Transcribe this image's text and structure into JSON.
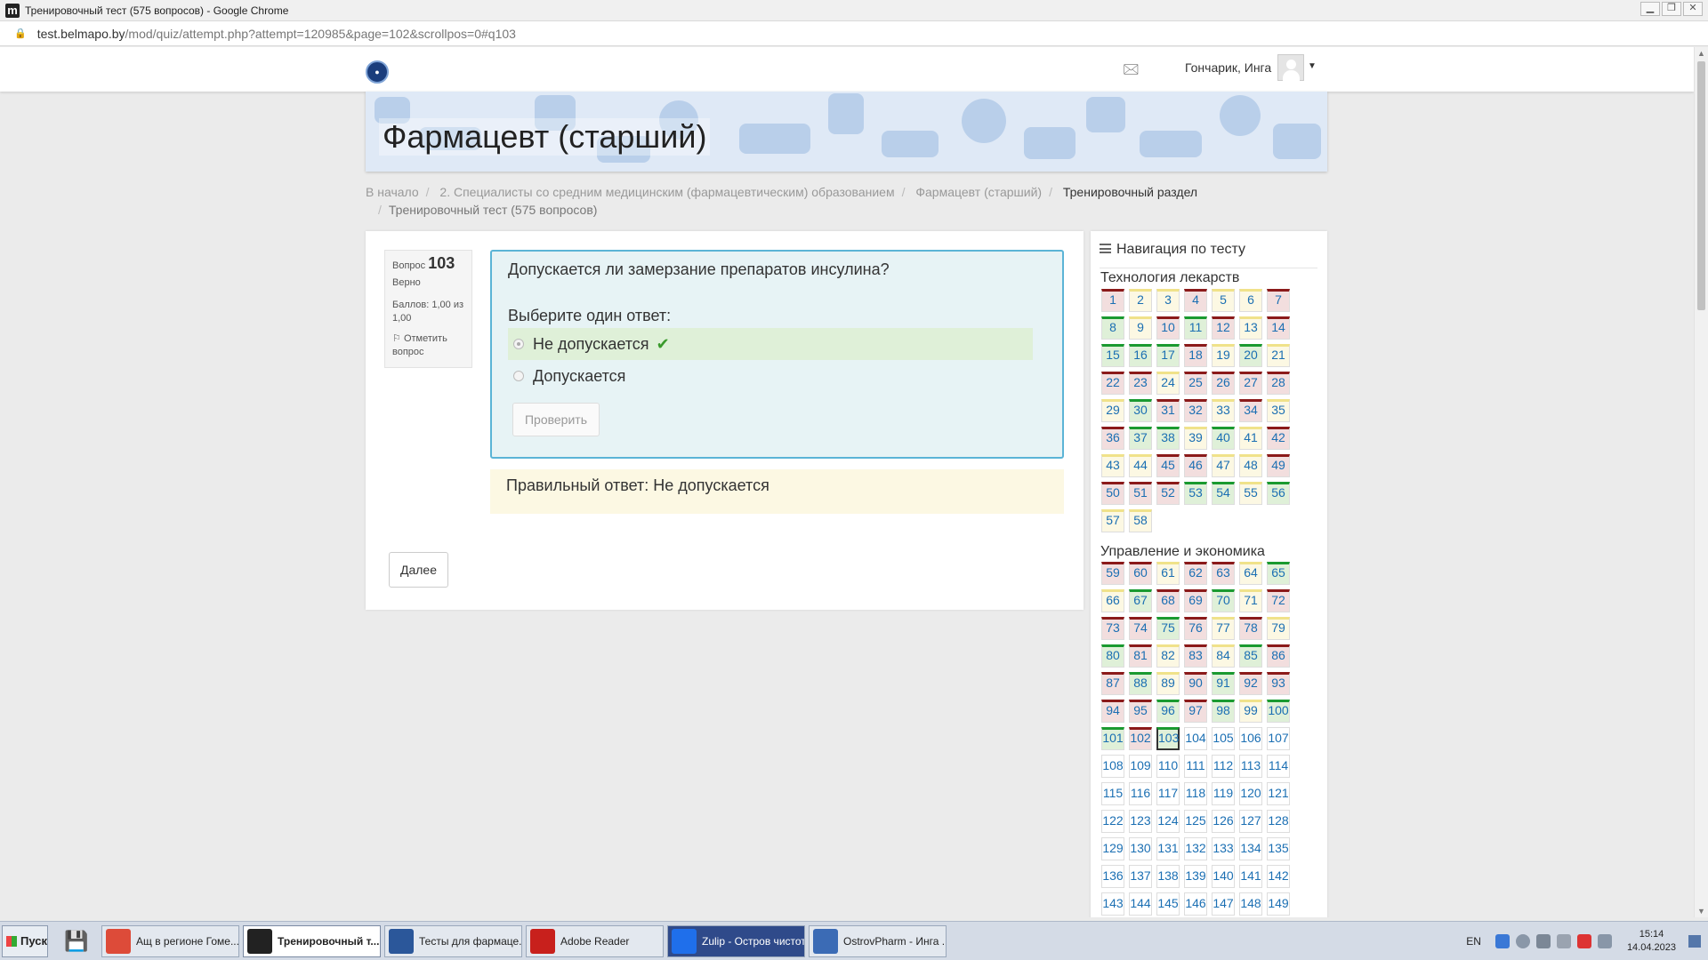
{
  "window": {
    "title": "Тренировочный тест (575 вопросов) - Google Chrome",
    "app_icon": "m"
  },
  "address": {
    "host": "test.belmapo.by",
    "path": "/mod/quiz/attempt.php?attempt=120985&page=102&scrollpos=0#q103"
  },
  "navbar": {
    "user_name": "Гончарик, Инга",
    "logo_icon": "belmapo-logo-icon",
    "messages_icon": "message-tray-icon"
  },
  "banner": {
    "title": "Фармацевт (старший)"
  },
  "breadcrumb": {
    "items": [
      "В начало",
      "2. Специалисты со средним медицинским (фармацевтическим) образованием",
      "Фармацевт (старший)",
      "Тренировочный раздел"
    ],
    "last": "Тренировочный тест (575 вопросов)"
  },
  "question": {
    "label": "Вопрос",
    "number": "103",
    "state": "Верно",
    "grade": "Баллов: 1,00 из 1,00",
    "flag_label": "Отметить вопрос",
    "text": "Допускается ли замерзание препаратов инсулина?",
    "prompt": "Выберите один ответ:",
    "answers": [
      {
        "text": "Не допускается",
        "selected": true,
        "correct": true
      },
      {
        "text": "Допускается",
        "selected": false,
        "correct": false
      }
    ],
    "check_label": "Проверить",
    "right_answer": "Правильный ответ: Не допускается",
    "next_label": "Далее"
  },
  "quiz_nav": {
    "title": "Навигация по тесту",
    "sections": [
      {
        "title": "Технология лекарств",
        "statuses": "iccipii cpiciip ccciccp iicii ii piiiipp cciii iic ppcic piiiiii ppcccpc"
      },
      {
        "title": "Управление и экономика"
      }
    ],
    "current": 103,
    "states": {
      "1": "i",
      "2": "p",
      "3": "p",
      "4": "i",
      "5": "p",
      "6": "p",
      "7": "i",
      "8": "c",
      "9": "p",
      "10": "i",
      "11": "c",
      "12": "i",
      "13": "p",
      "14": "i",
      "15": "c",
      "16": "c",
      "17": "c",
      "18": "i",
      "19": "p",
      "20": "c",
      "21": "p",
      "22": "i",
      "23": "i",
      "24": "p",
      "25": "i",
      "26": "i",
      "27": "i",
      "28": "i",
      "29": "p",
      "30": "c",
      "31": "i",
      "32": "i",
      "33": "p",
      "34": "i",
      "35": "p",
      "36": "i",
      "37": "c",
      "38": "c",
      "39": "p",
      "40": "c",
      "41": "p",
      "42": "i",
      "43": "p",
      "44": "p",
      "45": "i",
      "46": "i",
      "47": "p",
      "48": "p",
      "49": "i",
      "50": "i",
      "51": "i",
      "52": "i",
      "53": "c",
      "54": "c",
      "55": "p",
      "56": "c",
      "57": "p",
      "58": "p",
      "59": "i",
      "60": "i",
      "61": "p",
      "62": "i",
      "63": "i",
      "64": "p",
      "65": "c",
      "66": "p",
      "67": "c",
      "68": "i",
      "69": "i",
      "70": "c",
      "71": "p",
      "72": "i",
      "73": "i",
      "74": "i",
      "75": "c",
      "76": "i",
      "77": "p",
      "78": "i",
      "79": "p",
      "80": "c",
      "81": "i",
      "82": "p",
      "83": "i",
      "84": "p",
      "85": "c",
      "86": "i",
      "87": "i",
      "88": "c",
      "89": "p",
      "90": "i",
      "91": "c",
      "92": "i",
      "93": "i",
      "94": "i",
      "95": "i",
      "96": "c",
      "97": "i",
      "98": "c",
      "99": "p",
      "100": "c",
      "101": "c",
      "102": "i",
      "103": "c"
    }
  },
  "taskbar": {
    "start_label": "Пуск",
    "tasks": [
      {
        "label": "Ащ в регионе Гоме...",
        "icon": "chrome-icon",
        "color": "#dd4b39"
      },
      {
        "label": "Тренировочный т...",
        "icon": "moodle-icon",
        "color": "#222222",
        "active": true
      },
      {
        "label": "Тесты для фармаце...",
        "icon": "word-icon",
        "color": "#2b579a"
      },
      {
        "label": "Adobe Reader",
        "icon": "pdf-icon",
        "color": "#c8201c"
      },
      {
        "label": "Zulip - Остров чистоты",
        "icon": "zulip-icon",
        "color": "#1f6feb",
        "dark": true
      },
      {
        "label": "OstrovPharm - Инга ...",
        "icon": "ostrov-icon",
        "color": "#3b6bb5"
      }
    ],
    "lang": "EN",
    "time": "15:14",
    "date": "14.04.2023"
  },
  "colors": {
    "correct_bg": "#dff0d8",
    "partial_bg": "#fcf8e3",
    "incorrect_bg": "#f2dede",
    "link": "#1b6fb3",
    "accent": "#5bb4d6"
  }
}
